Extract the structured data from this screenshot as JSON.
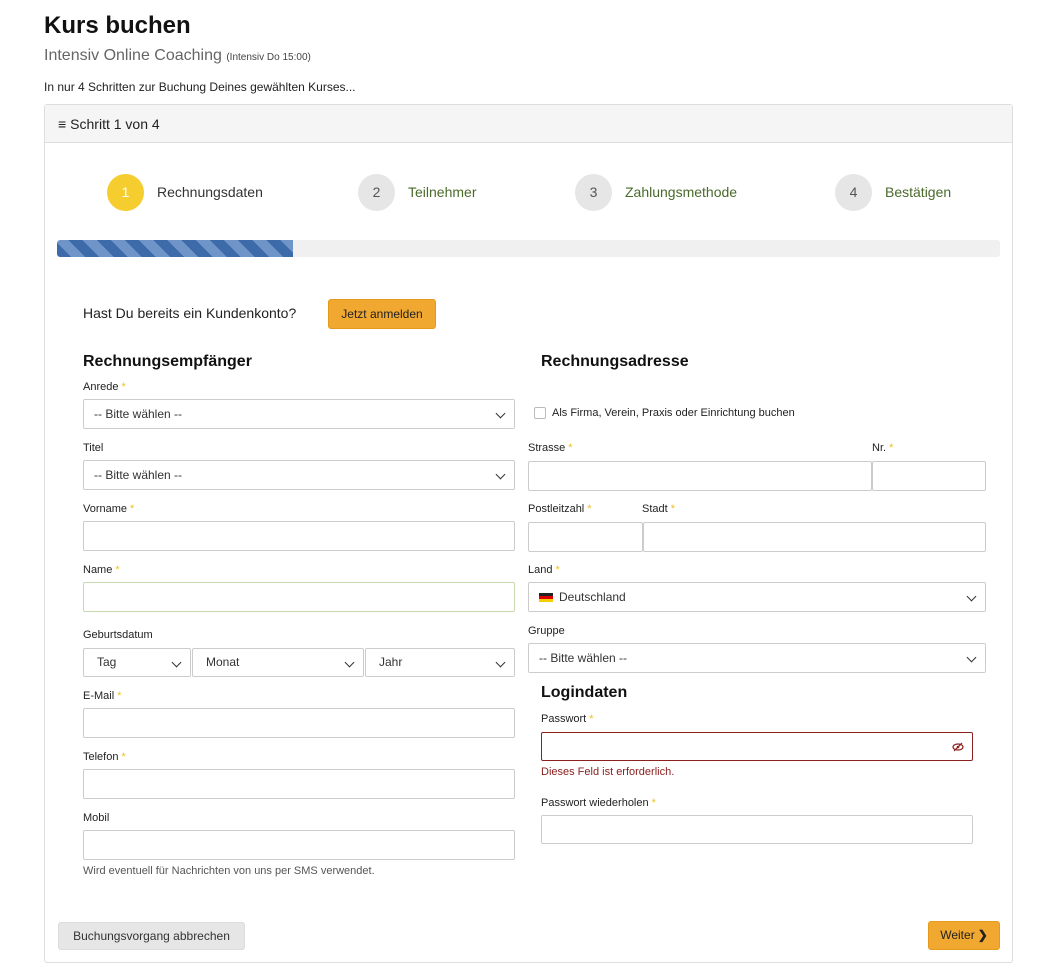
{
  "header": {
    "title": "Kurs buchen",
    "subtitle": "Intensiv Online Coaching",
    "subtitle_detail": "(Intensiv Do 15:00)",
    "intro": "In nur 4 Schritten zur Buchung Deines gewählten Kurses..."
  },
  "panel": {
    "step_indicator": "Schritt 1 von 4",
    "steps": [
      {
        "num": "1",
        "label": "Rechnungsdaten",
        "active": true
      },
      {
        "num": "2",
        "label": "Teilnehmer",
        "active": false
      },
      {
        "num": "3",
        "label": "Zahlungsmethode",
        "active": false
      },
      {
        "num": "4",
        "label": "Bestätigen",
        "active": false
      }
    ],
    "progress_fraction": 0.25
  },
  "login": {
    "question": "Hast Du bereits ein Kundenkonto?",
    "button": "Jetzt anmelden"
  },
  "recipient": {
    "heading": "Rechnungsempfänger",
    "salutation_label": "Anrede",
    "salutation_value": "-- Bitte wählen --",
    "title_label": "Titel",
    "title_value": "-- Bitte wählen --",
    "firstname_label": "Vorname",
    "lastname_label": "Name",
    "birthdate_label": "Geburtsdatum",
    "day_value": "Tag",
    "month_value": "Monat",
    "year_value": "Jahr",
    "email_label": "E-Mail",
    "phone_label": "Telefon",
    "mobile_label": "Mobil",
    "mobile_hint": "Wird eventuell für Nachrichten von uns per SMS verwendet.",
    "required_mark": "*"
  },
  "address": {
    "heading": "Rechnungsadresse",
    "company_checkbox": "Als Firma, Verein, Praxis oder Einrichtung buchen",
    "street_label": "Strasse",
    "number_label": "Nr.",
    "zip_label": "Postleitzahl",
    "city_label": "Stadt",
    "country_label": "Land",
    "country_value": "Deutschland",
    "group_label": "Gruppe",
    "group_value": "-- Bitte wählen --"
  },
  "logindata": {
    "heading": "Logindaten",
    "password_label": "Passwort",
    "password_error": "Dieses Feld ist erforderlich.",
    "password_repeat_label": "Passwort wiederholen"
  },
  "footer": {
    "cancel": "Buchungsvorgang abbrechen",
    "next": "Weiter"
  },
  "colors": {
    "accent": "#f0a830",
    "active_step": "#f6cd2f",
    "progress": "#3d6aa8",
    "error": "#8b2020",
    "required": "#f0c020"
  }
}
